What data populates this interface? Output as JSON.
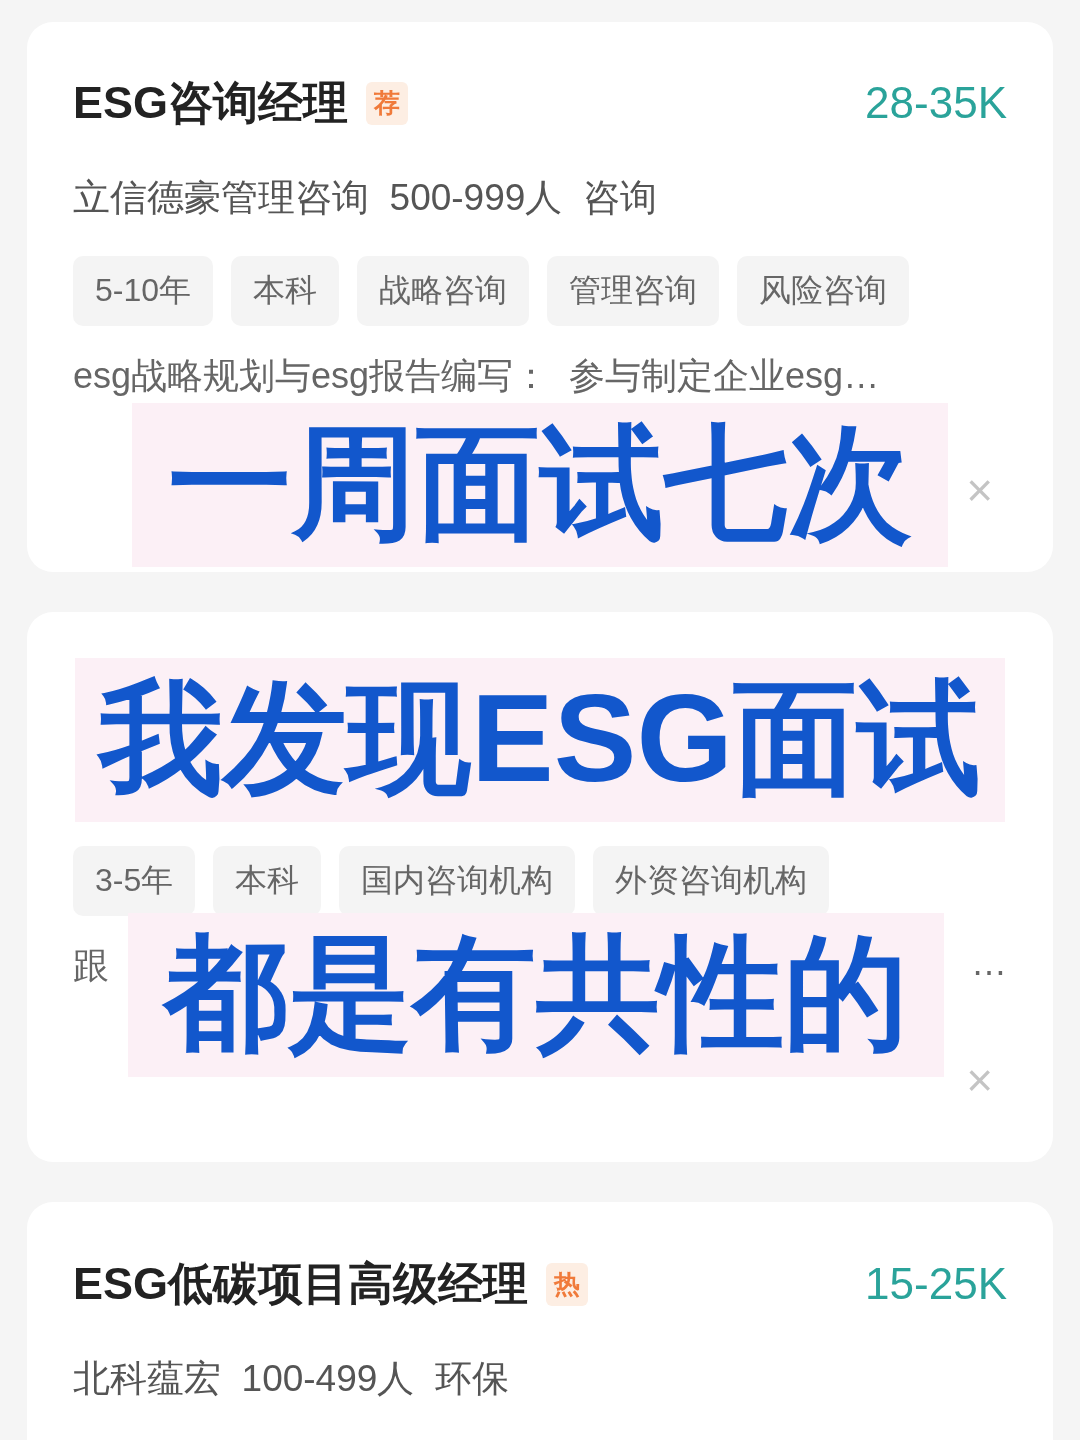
{
  "cards": [
    {
      "title": "ESG咨询经理",
      "badge": "荐",
      "salary": "28-35K",
      "company_line": "立信德豪管理咨询  500-999人  咨询",
      "tags": [
        "5-10年",
        "本科",
        "战略咨询",
        "管理咨询",
        "风险咨询"
      ],
      "description": "esg战略规划与esg报告编写：  参与制定企业esg…",
      "close": "×"
    },
    {
      "tags": [
        "3-5年",
        "本科",
        "国内咨询机构",
        "外资咨询机构"
      ],
      "description_fragments": [
        "跟",
        "…"
      ],
      "close": "×"
    },
    {
      "title": "ESG低碳项目高级经理",
      "badge": "热",
      "salary": "15-25K",
      "company_line": "北科蕴宏  100-499人  环保"
    }
  ],
  "captions": [
    "一周面试七次",
    "我发现ESG面试",
    "都是有共性的"
  ]
}
